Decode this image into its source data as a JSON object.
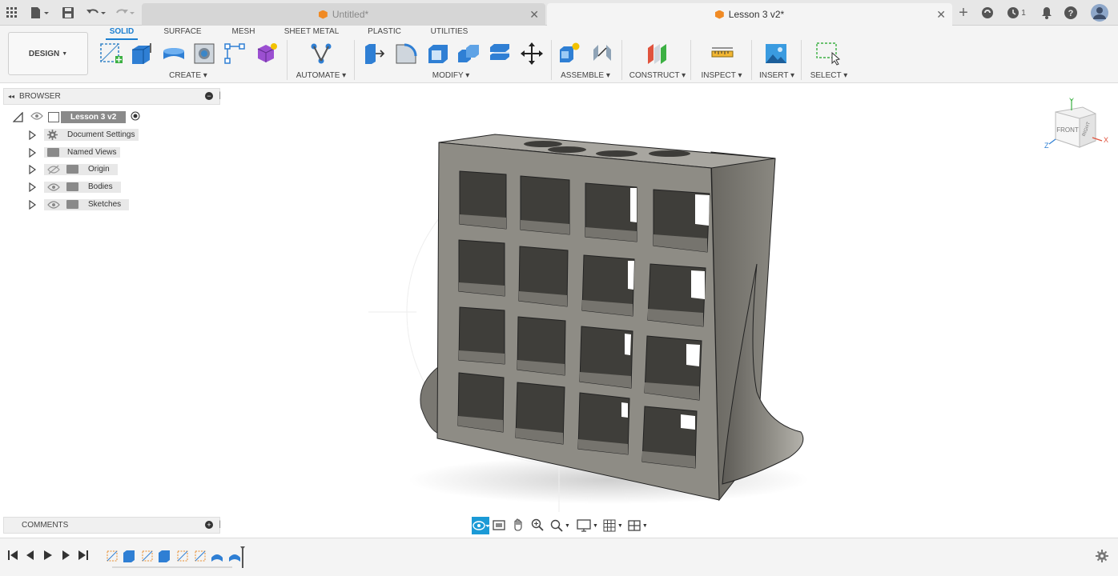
{
  "tabs": [
    {
      "label": "Untitled*"
    },
    {
      "label": "Lesson 3 v2*"
    }
  ],
  "titlebar": {
    "job_count": "1"
  },
  "toolbar": {
    "workspace": "DESIGN",
    "workspace_tabs": [
      "SOLID",
      "SURFACE",
      "MESH",
      "SHEET METAL",
      "PLASTIC",
      "UTILITIES"
    ],
    "groups": [
      "CREATE",
      "AUTOMATE",
      "MODIFY",
      "ASSEMBLE",
      "CONSTRUCT",
      "INSPECT",
      "INSERT",
      "SELECT"
    ]
  },
  "browser": {
    "title": "BROWSER",
    "root": "Lesson 3 v2",
    "items": [
      {
        "label": "Document Settings"
      },
      {
        "label": "Named Views"
      },
      {
        "label": "Origin"
      },
      {
        "label": "Bodies"
      },
      {
        "label": "Sketches"
      }
    ]
  },
  "comments": {
    "title": "COMMENTS"
  },
  "viewcube": {
    "front": "FRONT",
    "right": "RIGHT",
    "x": "X",
    "y": "Y",
    "z": "Z"
  },
  "colors": {
    "accent": "#1b7fd1",
    "model": "#8e8c85",
    "brand": "#f08a24"
  }
}
